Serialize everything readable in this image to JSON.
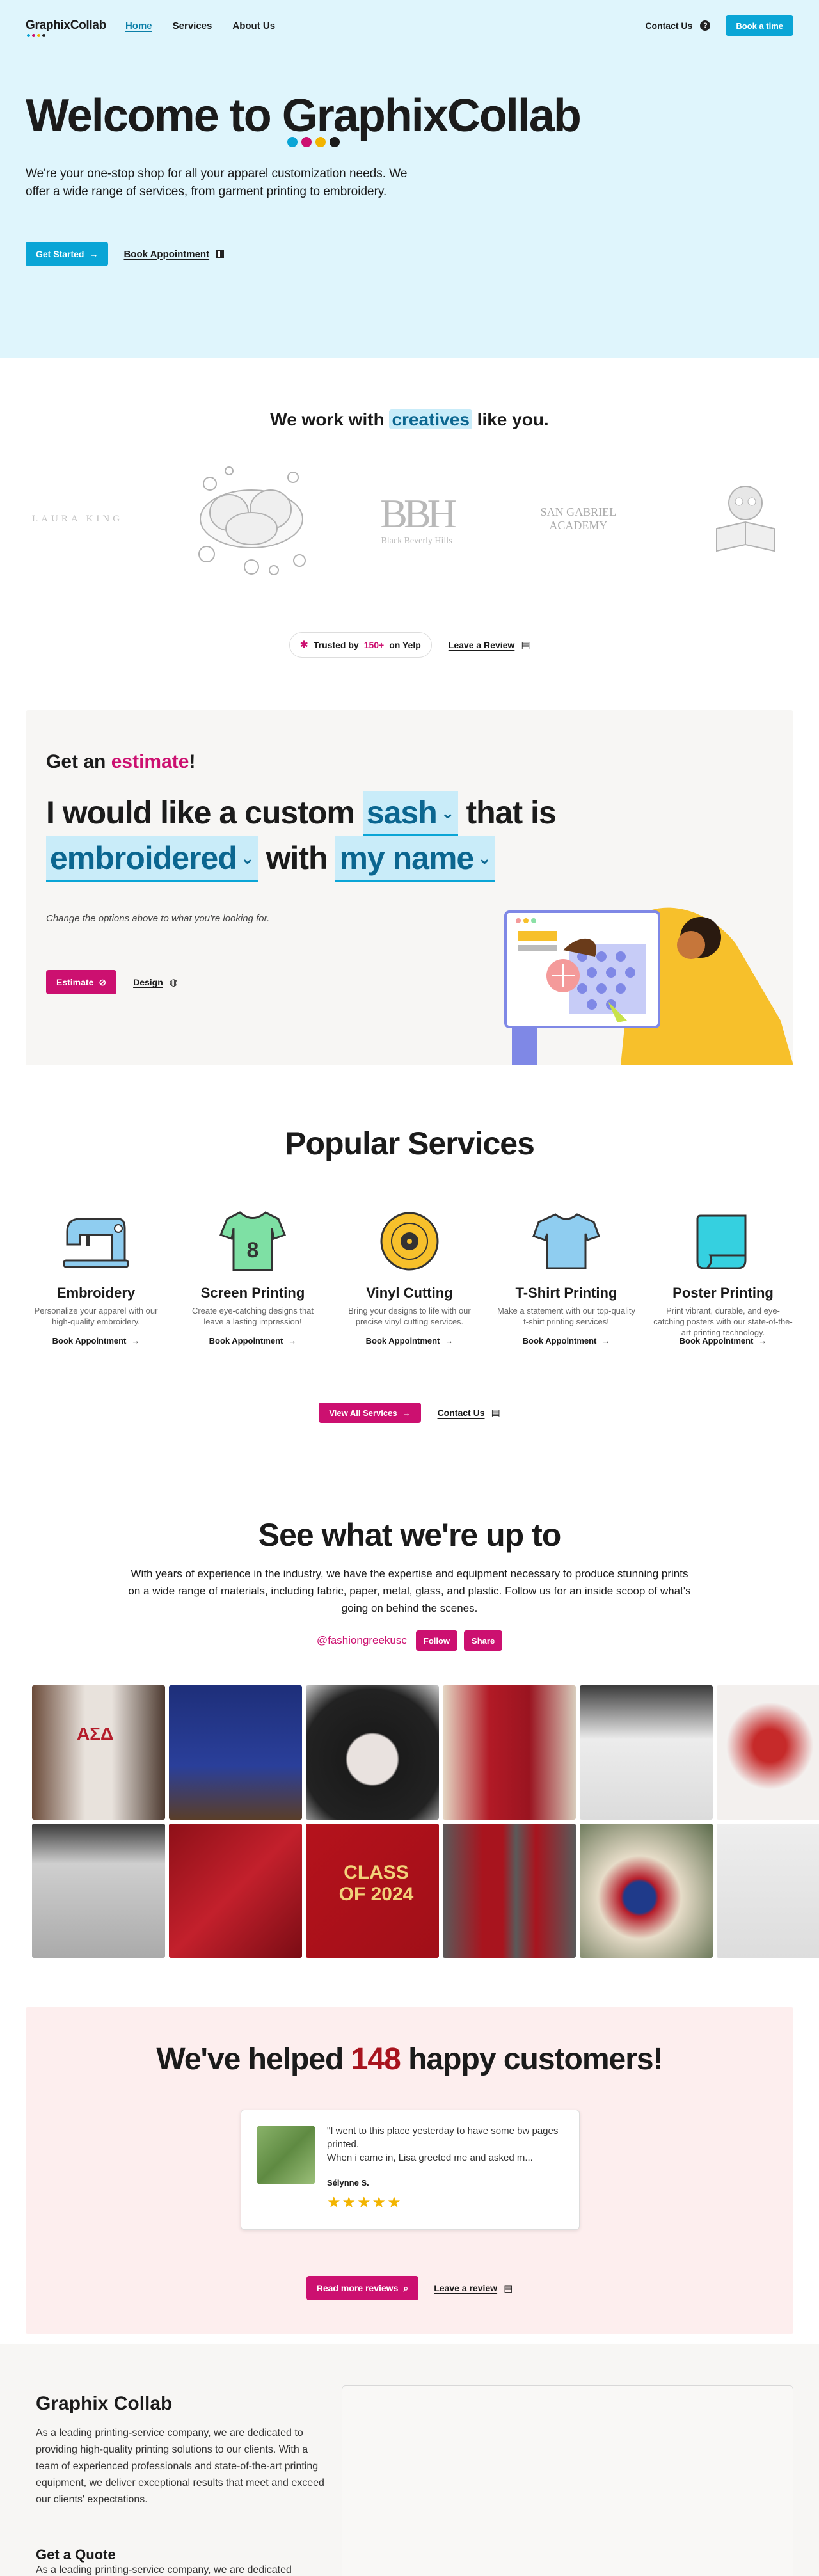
{
  "brand": {
    "name": "GraphixCollab",
    "dot_colors": [
      "#0aa5d6",
      "#cc1070",
      "#f2b400",
      "#1b1b1b"
    ]
  },
  "nav": {
    "items": [
      "Home",
      "Services",
      "About Us"
    ],
    "contact": "Contact Us",
    "help": "?",
    "book": "Book a time"
  },
  "hero": {
    "title_prefix": "Welcome to",
    "title_brand": "GraphixCollab",
    "body": "We're your one-stop shop for all your apparel customization needs. We offer a wide range of services, from garment printing to embroidery.",
    "cta": "Get Started",
    "secondary": "Book Appointment"
  },
  "creatives": {
    "pre": "We work with",
    "highlight": "creatives",
    "post": "like you.",
    "client_logos": [
      "LAURA KING",
      "BBH",
      "Black Beverly Hills",
      "SAN GABRIEL ACADEMY"
    ]
  },
  "trust": {
    "pre": "Trusted by",
    "count": "150+",
    "post": "on Yelp",
    "review": "Leave a Review"
  },
  "estimate": {
    "heading_pre": "Get an",
    "heading_hl": "estimate",
    "heading_post": "!",
    "s1": "I would like a custom",
    "opt1": "sash",
    "s2": "that is",
    "opt2": "embroidered",
    "s3": "with",
    "opt3": "my name",
    "note": "Change the options above to what you're looking for.",
    "button": "Estimate",
    "design": "Design"
  },
  "services": {
    "title": "Popular Services",
    "items": [
      {
        "name": "Embroidery",
        "desc": "Personalize your apparel with our high-quality embroidery.",
        "link": "Book Appointment"
      },
      {
        "name": "Screen Printing",
        "desc": "Create eye-catching designs that leave a lasting impression!",
        "link": "Book Appointment"
      },
      {
        "name": "Vinyl Cutting",
        "desc": "Bring your designs to life with our precise vinyl cutting services.",
        "link": "Book Appointment"
      },
      {
        "name": "T-Shirt Printing",
        "desc": "Make a statement with our top-quality t-shirt printing services!",
        "link": "Book Appointment"
      },
      {
        "name": "Poster Printing",
        "desc": "Print vibrant, durable, and eye-catching posters with our state-of-the-art printing technology.",
        "link": "Book Appointment"
      }
    ],
    "shirt_number": "8",
    "all": "View All Services",
    "contact": "Contact Us"
  },
  "social": {
    "title": "See what we're up to",
    "body": "With years of experience in the industry, we have the expertise and equipment necessary to produce stunning prints on a wide range of materials, including fabric, paper, metal, glass, and plastic. Follow us for an inside scoop of what's going on behind the scenes.",
    "handle": "@fashiongreekusc",
    "follow": "Follow",
    "share": "Share",
    "photo_text": [
      "ΑΣΔ",
      "CLASS OF 2024"
    ]
  },
  "reviews": {
    "pre": "We've helped",
    "count": "148",
    "post": "happy customers!",
    "quote": "\"I went to this place yesterday to have some bw pages printed.\nWhen i came in, Lisa greeted me and asked m...",
    "name": "Sélynne S.",
    "stars": "★★★★★",
    "more": "Read more reviews",
    "leave": "Leave a review"
  },
  "footer": {
    "title": "Graphix Collab",
    "body": "As a leading printing-service company, we are dedicated to providing high-quality printing solutions to our clients. With a team of experienced professionals and state-of-the-art printing equipment, we deliver exceptional results that meet and exceed our clients' expectations.",
    "quote_title": "Get a Quote",
    "quote_body": "As a leading printing-service company, we are dedicated"
  }
}
